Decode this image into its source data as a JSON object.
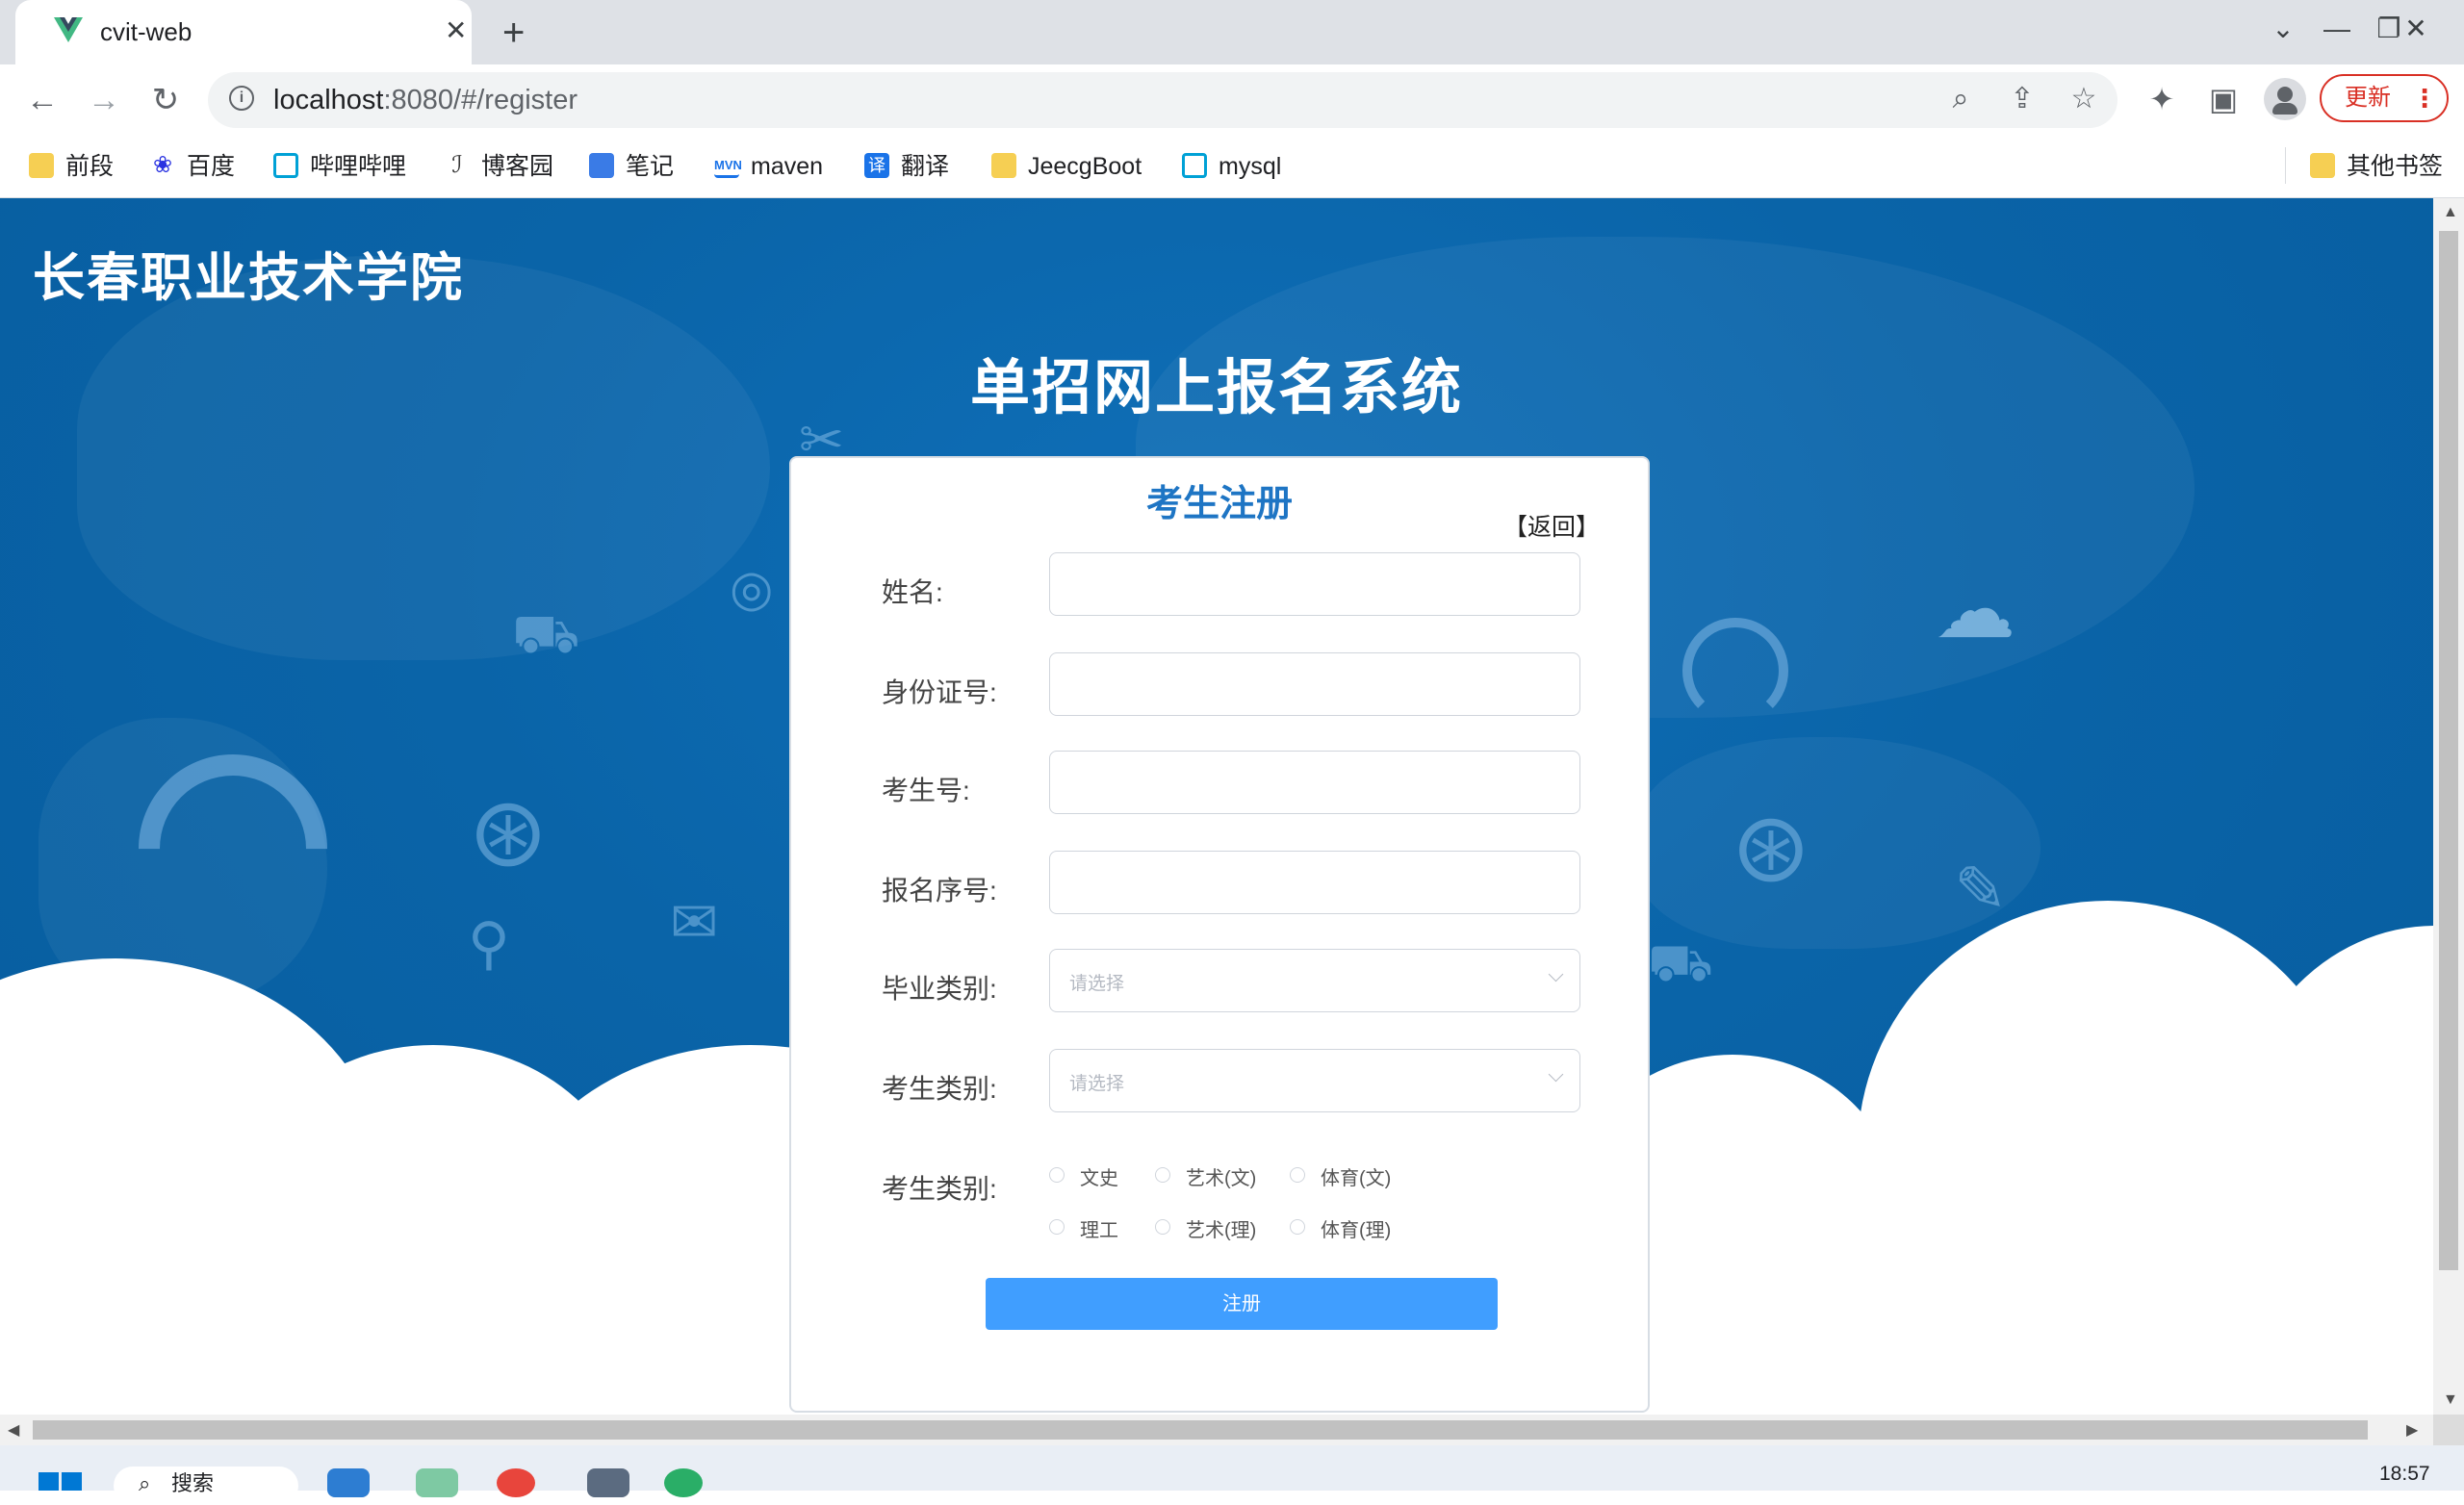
{
  "browser": {
    "tab_title": "cvit-web",
    "url_host": "localhost",
    "url_path": ":8080/#/register",
    "update_label": "更新",
    "bookmarks": [
      "前段",
      "百度",
      "哔哩哔哩",
      "博客园",
      "笔记",
      "maven",
      "翻译",
      "JeecgBoot",
      "mysql"
    ],
    "other_bookmarks": "其他书签"
  },
  "page": {
    "school_name": "长春职业技术学院",
    "system_title": "单招网上报名系统"
  },
  "form": {
    "title": "考生注册",
    "back_link": "【返回】",
    "fields": {
      "name_label": "姓名:",
      "id_card_label": "身份证号:",
      "exam_no_label": "考生号:",
      "reg_no_label": "报名序号:",
      "grad_type_label": "毕业类别:",
      "grad_type_placeholder": "请选择",
      "exam_type_label": "考生类别:",
      "exam_type_placeholder": "请选择",
      "subject_type_label": "考生类别:"
    },
    "radio_options": [
      "文史",
      "艺术(文)",
      "体育(文)",
      "理工",
      "艺术(理)",
      "体育(理)"
    ],
    "submit_label": "注册"
  },
  "taskbar": {
    "search_label": "搜索",
    "clock": "18:57"
  },
  "colors": {
    "page_blue": "#0a64a8",
    "accent_blue": "#409eff",
    "title_blue": "#1e75c4"
  }
}
